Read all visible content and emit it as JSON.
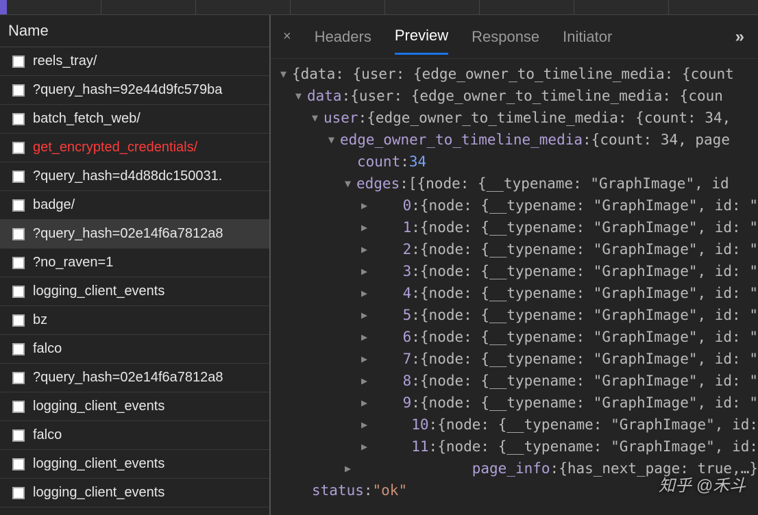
{
  "columns": {
    "name_header": "Name"
  },
  "tabs": {
    "headers": "Headers",
    "preview": "Preview",
    "response": "Response",
    "initiator": "Initiator",
    "overflow": "»",
    "close": "×"
  },
  "requests": [
    {
      "name": "reels_tray/",
      "error": false,
      "selected": false
    },
    {
      "name": "?query_hash=92e44d9fc579ba",
      "error": false,
      "selected": false
    },
    {
      "name": "batch_fetch_web/",
      "error": false,
      "selected": false
    },
    {
      "name": "get_encrypted_credentials/",
      "error": true,
      "selected": false
    },
    {
      "name": "?query_hash=d4d88dc150031.",
      "error": false,
      "selected": false
    },
    {
      "name": "badge/",
      "error": false,
      "selected": false
    },
    {
      "name": "?query_hash=02e14f6a7812a8",
      "error": false,
      "selected": true
    },
    {
      "name": "?no_raven=1",
      "error": false,
      "selected": false
    },
    {
      "name": "logging_client_events",
      "error": false,
      "selected": false
    },
    {
      "name": "bz",
      "error": false,
      "selected": false
    },
    {
      "name": "falco",
      "error": false,
      "selected": false
    },
    {
      "name": "?query_hash=02e14f6a7812a8",
      "error": false,
      "selected": false
    },
    {
      "name": "logging_client_events",
      "error": false,
      "selected": false
    },
    {
      "name": "falco",
      "error": false,
      "selected": false
    },
    {
      "name": "logging_client_events",
      "error": false,
      "selected": false
    },
    {
      "name": "logging_client_events",
      "error": false,
      "selected": false
    }
  ],
  "preview": {
    "root_summary": "{data: {user: {edge_owner_to_timeline_media: {count",
    "data_key": "data",
    "data_summary": "{user: {edge_owner_to_timeline_media: {coun",
    "user_key": "user",
    "user_summary": "{edge_owner_to_timeline_media: {count: 34,",
    "edge_key": "edge_owner_to_timeline_media",
    "edge_summary": "{count: 34, page",
    "count_key": "count",
    "count_value": "34",
    "edges_key": "edges",
    "edges_summary": "[{node: {__typename: \"GraphImage\", id",
    "node_summary": "{node: {__typename: \"GraphImage\", id: \"",
    "node_summary_short": "{node: {__typename: \"GraphImage\", id:",
    "page_info_key": "page_info",
    "page_info_summary": "{has_next_page: true,…}",
    "status_key": "status",
    "status_value": "\"ok\"",
    "edge_indices": [
      "0",
      "1",
      "2",
      "3",
      "4",
      "5",
      "6",
      "7",
      "8",
      "9",
      "10",
      "11"
    ]
  },
  "watermark": "知乎 @禾斗"
}
